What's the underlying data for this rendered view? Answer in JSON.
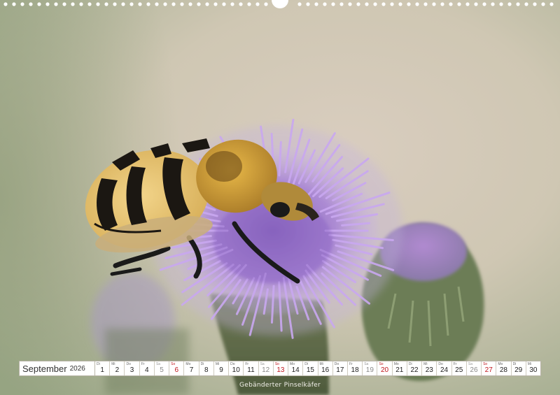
{
  "calendar": {
    "month": "September",
    "year": "2026",
    "days": [
      {
        "wd": "Di",
        "d": "1",
        "type": "work"
      },
      {
        "wd": "Mi",
        "d": "2",
        "type": "work"
      },
      {
        "wd": "Do",
        "d": "3",
        "type": "work"
      },
      {
        "wd": "Fr",
        "d": "4",
        "type": "work"
      },
      {
        "wd": "Sa",
        "d": "5",
        "type": "sat"
      },
      {
        "wd": "So",
        "d": "6",
        "type": "sun"
      },
      {
        "wd": "Mo",
        "d": "7",
        "type": "work"
      },
      {
        "wd": "Di",
        "d": "8",
        "type": "work"
      },
      {
        "wd": "Mi",
        "d": "9",
        "type": "work"
      },
      {
        "wd": "Do",
        "d": "10",
        "type": "work"
      },
      {
        "wd": "Fr",
        "d": "11",
        "type": "work"
      },
      {
        "wd": "Sa",
        "d": "12",
        "type": "sat"
      },
      {
        "wd": "So",
        "d": "13",
        "type": "sun"
      },
      {
        "wd": "Mo",
        "d": "14",
        "type": "work"
      },
      {
        "wd": "Di",
        "d": "15",
        "type": "work"
      },
      {
        "wd": "Mi",
        "d": "16",
        "type": "work"
      },
      {
        "wd": "Do",
        "d": "17",
        "type": "work"
      },
      {
        "wd": "Fr",
        "d": "18",
        "type": "work"
      },
      {
        "wd": "Sa",
        "d": "19",
        "type": "sat"
      },
      {
        "wd": "So",
        "d": "20",
        "type": "sun"
      },
      {
        "wd": "Mo",
        "d": "21",
        "type": "work"
      },
      {
        "wd": "Di",
        "d": "22",
        "type": "work"
      },
      {
        "wd": "Mi",
        "d": "23",
        "type": "work"
      },
      {
        "wd": "Do",
        "d": "24",
        "type": "work"
      },
      {
        "wd": "Fr",
        "d": "25",
        "type": "work"
      },
      {
        "wd": "Sa",
        "d": "26",
        "type": "sat"
      },
      {
        "wd": "So",
        "d": "27",
        "type": "sun"
      },
      {
        "wd": "Mo",
        "d": "28",
        "type": "work"
      },
      {
        "wd": "Di",
        "d": "29",
        "type": "work"
      },
      {
        "wd": "Mi",
        "d": "30",
        "type": "work"
      }
    ]
  },
  "caption": "Gebänderter Pinselkäfer",
  "colors": {
    "sunday": "#c0181f",
    "saturday": "#8a8a8a",
    "thistle": "#b08ad8",
    "beetle_yellow": "#e8c060"
  },
  "photo_subject": "beetle-on-thistle"
}
